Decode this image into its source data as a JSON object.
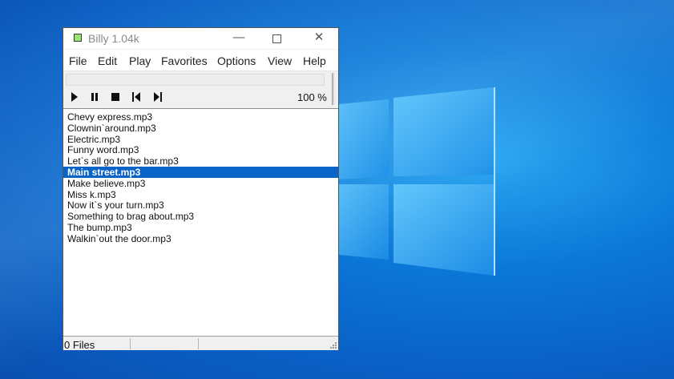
{
  "window": {
    "title": "Billy 1.04k",
    "minimize_glyph": "—",
    "close_glyph": "✕"
  },
  "menu": [
    "File",
    "Edit",
    "Play",
    "Favorites",
    "Options",
    "View",
    "Help"
  ],
  "player": {
    "progress_fraction": 0,
    "volume": "100 %",
    "controls": [
      "play-icon",
      "pause-icon",
      "stop-icon",
      "previous-track-icon",
      "next-track-icon"
    ]
  },
  "playlist": {
    "selected_index": 5,
    "items": [
      "Chevy express.mp3",
      "Clownin`around.mp3",
      "Electric.mp3",
      "Funny word.mp3",
      "Let`s all go to the bar.mp3",
      "Main street.mp3",
      "Make believe.mp3",
      "Miss k.mp3",
      "Now it`s your turn.mp3",
      "Something to brag about.mp3",
      "The bump.mp3",
      "Walkin`out the door.mp3"
    ]
  },
  "status": {
    "files": "0 Files"
  },
  "colors": {
    "selection": "#0a64c8",
    "desktop": "#0b78d8",
    "app_icon": "#9be36e"
  }
}
